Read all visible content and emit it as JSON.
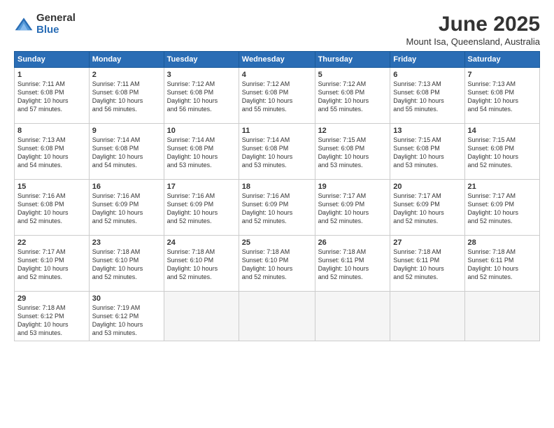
{
  "logo": {
    "general": "General",
    "blue": "Blue"
  },
  "title": "June 2025",
  "subtitle": "Mount Isa, Queensland, Australia",
  "days_header": [
    "Sunday",
    "Monday",
    "Tuesday",
    "Wednesday",
    "Thursday",
    "Friday",
    "Saturday"
  ],
  "weeks": [
    [
      {
        "day": "1",
        "info": "Sunrise: 7:11 AM\nSunset: 6:08 PM\nDaylight: 10 hours\nand 57 minutes."
      },
      {
        "day": "2",
        "info": "Sunrise: 7:11 AM\nSunset: 6:08 PM\nDaylight: 10 hours\nand 56 minutes."
      },
      {
        "day": "3",
        "info": "Sunrise: 7:12 AM\nSunset: 6:08 PM\nDaylight: 10 hours\nand 56 minutes."
      },
      {
        "day": "4",
        "info": "Sunrise: 7:12 AM\nSunset: 6:08 PM\nDaylight: 10 hours\nand 55 minutes."
      },
      {
        "day": "5",
        "info": "Sunrise: 7:12 AM\nSunset: 6:08 PM\nDaylight: 10 hours\nand 55 minutes."
      },
      {
        "day": "6",
        "info": "Sunrise: 7:13 AM\nSunset: 6:08 PM\nDaylight: 10 hours\nand 55 minutes."
      },
      {
        "day": "7",
        "info": "Sunrise: 7:13 AM\nSunset: 6:08 PM\nDaylight: 10 hours\nand 54 minutes."
      }
    ],
    [
      {
        "day": "8",
        "info": "Sunrise: 7:13 AM\nSunset: 6:08 PM\nDaylight: 10 hours\nand 54 minutes."
      },
      {
        "day": "9",
        "info": "Sunrise: 7:14 AM\nSunset: 6:08 PM\nDaylight: 10 hours\nand 54 minutes."
      },
      {
        "day": "10",
        "info": "Sunrise: 7:14 AM\nSunset: 6:08 PM\nDaylight: 10 hours\nand 53 minutes."
      },
      {
        "day": "11",
        "info": "Sunrise: 7:14 AM\nSunset: 6:08 PM\nDaylight: 10 hours\nand 53 minutes."
      },
      {
        "day": "12",
        "info": "Sunrise: 7:15 AM\nSunset: 6:08 PM\nDaylight: 10 hours\nand 53 minutes."
      },
      {
        "day": "13",
        "info": "Sunrise: 7:15 AM\nSunset: 6:08 PM\nDaylight: 10 hours\nand 53 minutes."
      },
      {
        "day": "14",
        "info": "Sunrise: 7:15 AM\nSunset: 6:08 PM\nDaylight: 10 hours\nand 52 minutes."
      }
    ],
    [
      {
        "day": "15",
        "info": "Sunrise: 7:16 AM\nSunset: 6:08 PM\nDaylight: 10 hours\nand 52 minutes."
      },
      {
        "day": "16",
        "info": "Sunrise: 7:16 AM\nSunset: 6:09 PM\nDaylight: 10 hours\nand 52 minutes."
      },
      {
        "day": "17",
        "info": "Sunrise: 7:16 AM\nSunset: 6:09 PM\nDaylight: 10 hours\nand 52 minutes."
      },
      {
        "day": "18",
        "info": "Sunrise: 7:16 AM\nSunset: 6:09 PM\nDaylight: 10 hours\nand 52 minutes."
      },
      {
        "day": "19",
        "info": "Sunrise: 7:17 AM\nSunset: 6:09 PM\nDaylight: 10 hours\nand 52 minutes."
      },
      {
        "day": "20",
        "info": "Sunrise: 7:17 AM\nSunset: 6:09 PM\nDaylight: 10 hours\nand 52 minutes."
      },
      {
        "day": "21",
        "info": "Sunrise: 7:17 AM\nSunset: 6:09 PM\nDaylight: 10 hours\nand 52 minutes."
      }
    ],
    [
      {
        "day": "22",
        "info": "Sunrise: 7:17 AM\nSunset: 6:10 PM\nDaylight: 10 hours\nand 52 minutes."
      },
      {
        "day": "23",
        "info": "Sunrise: 7:18 AM\nSunset: 6:10 PM\nDaylight: 10 hours\nand 52 minutes."
      },
      {
        "day": "24",
        "info": "Sunrise: 7:18 AM\nSunset: 6:10 PM\nDaylight: 10 hours\nand 52 minutes."
      },
      {
        "day": "25",
        "info": "Sunrise: 7:18 AM\nSunset: 6:10 PM\nDaylight: 10 hours\nand 52 minutes."
      },
      {
        "day": "26",
        "info": "Sunrise: 7:18 AM\nSunset: 6:11 PM\nDaylight: 10 hours\nand 52 minutes."
      },
      {
        "day": "27",
        "info": "Sunrise: 7:18 AM\nSunset: 6:11 PM\nDaylight: 10 hours\nand 52 minutes."
      },
      {
        "day": "28",
        "info": "Sunrise: 7:18 AM\nSunset: 6:11 PM\nDaylight: 10 hours\nand 52 minutes."
      }
    ],
    [
      {
        "day": "29",
        "info": "Sunrise: 7:18 AM\nSunset: 6:12 PM\nDaylight: 10 hours\nand 53 minutes."
      },
      {
        "day": "30",
        "info": "Sunrise: 7:19 AM\nSunset: 6:12 PM\nDaylight: 10 hours\nand 53 minutes."
      },
      {
        "day": "",
        "info": ""
      },
      {
        "day": "",
        "info": ""
      },
      {
        "day": "",
        "info": ""
      },
      {
        "day": "",
        "info": ""
      },
      {
        "day": "",
        "info": ""
      }
    ]
  ]
}
